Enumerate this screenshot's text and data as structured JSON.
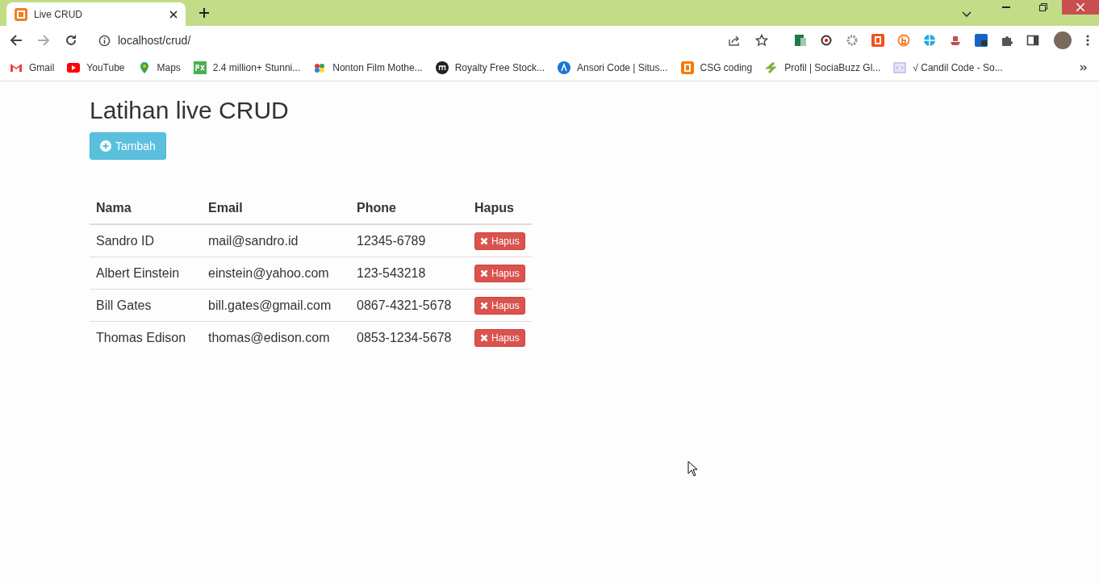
{
  "browser": {
    "tab": {
      "title": "Live CRUD",
      "selected": true
    },
    "address": "localhost/crud/",
    "bookmarks": [
      {
        "label": "Gmail"
      },
      {
        "label": "YouTube"
      },
      {
        "label": "Maps"
      },
      {
        "label": "2.4 million+ Stunni..."
      },
      {
        "label": "Nonton Film Mothe..."
      },
      {
        "label": "Royalty Free Stock..."
      },
      {
        "label": "Ansori Code | Situs..."
      },
      {
        "label": "CSG coding"
      },
      {
        "label": "Profil | SociaBuzz Gl..."
      },
      {
        "label": "√ Candil Code - So..."
      }
    ]
  },
  "page": {
    "title": "Latihan live CRUD",
    "add_button": "Tambah",
    "table": {
      "columns": [
        "Nama",
        "Email",
        "Phone",
        "Hapus"
      ],
      "rows": [
        {
          "name": "Sandro ID",
          "email": "mail@sandro.id",
          "phone": "12345-6789",
          "delete": "Hapus"
        },
        {
          "name": "Albert Einstein",
          "email": "einstein@yahoo.com",
          "phone": "123-543218",
          "delete": "Hapus"
        },
        {
          "name": "Bill Gates",
          "email": "bill.gates@gmail.com",
          "phone": "0867-4321-5678",
          "delete": "Hapus"
        },
        {
          "name": "Thomas Edison",
          "email": "thomas@edison.com",
          "phone": "0853-1234-5678",
          "delete": "Hapus"
        }
      ]
    }
  }
}
